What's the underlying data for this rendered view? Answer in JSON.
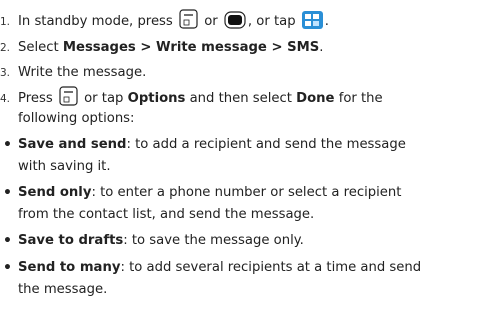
{
  "steps": [
    {
      "num": "1.",
      "pre": "In standby mode, press ",
      "or1": " or ",
      "or2": ", or tap ",
      "post": "."
    },
    {
      "num": "2.",
      "pre": "Select ",
      "bold": "Messages > Write message > SMS",
      "post": "."
    },
    {
      "num": "3.",
      "text": "Write the message."
    },
    {
      "num": "4.",
      "pre": "Press ",
      "mid": " or tap ",
      "bold1": "Options",
      "mid2": " and then select ",
      "bold2": "Done",
      "post": " for the",
      "line2": "following options:"
    }
  ],
  "options": [
    {
      "bold": "Save and send",
      "text": ": to add a recipient and send the message",
      "line2": "with saving it."
    },
    {
      "bold": "Send only",
      "text": ": to enter a phone number or select a recipient",
      "line2": "from the contact list, and send the message."
    },
    {
      "bold": "Save to drafts",
      "text": ": to save the message only."
    },
    {
      "bold": "Send to many",
      "text": ": to add several recipients at a time and send",
      "line2": "the message."
    }
  ],
  "icons": {
    "key1": "left-softkey-icon",
    "key2": "center-key-icon",
    "tap": "touch-menu-icon"
  }
}
